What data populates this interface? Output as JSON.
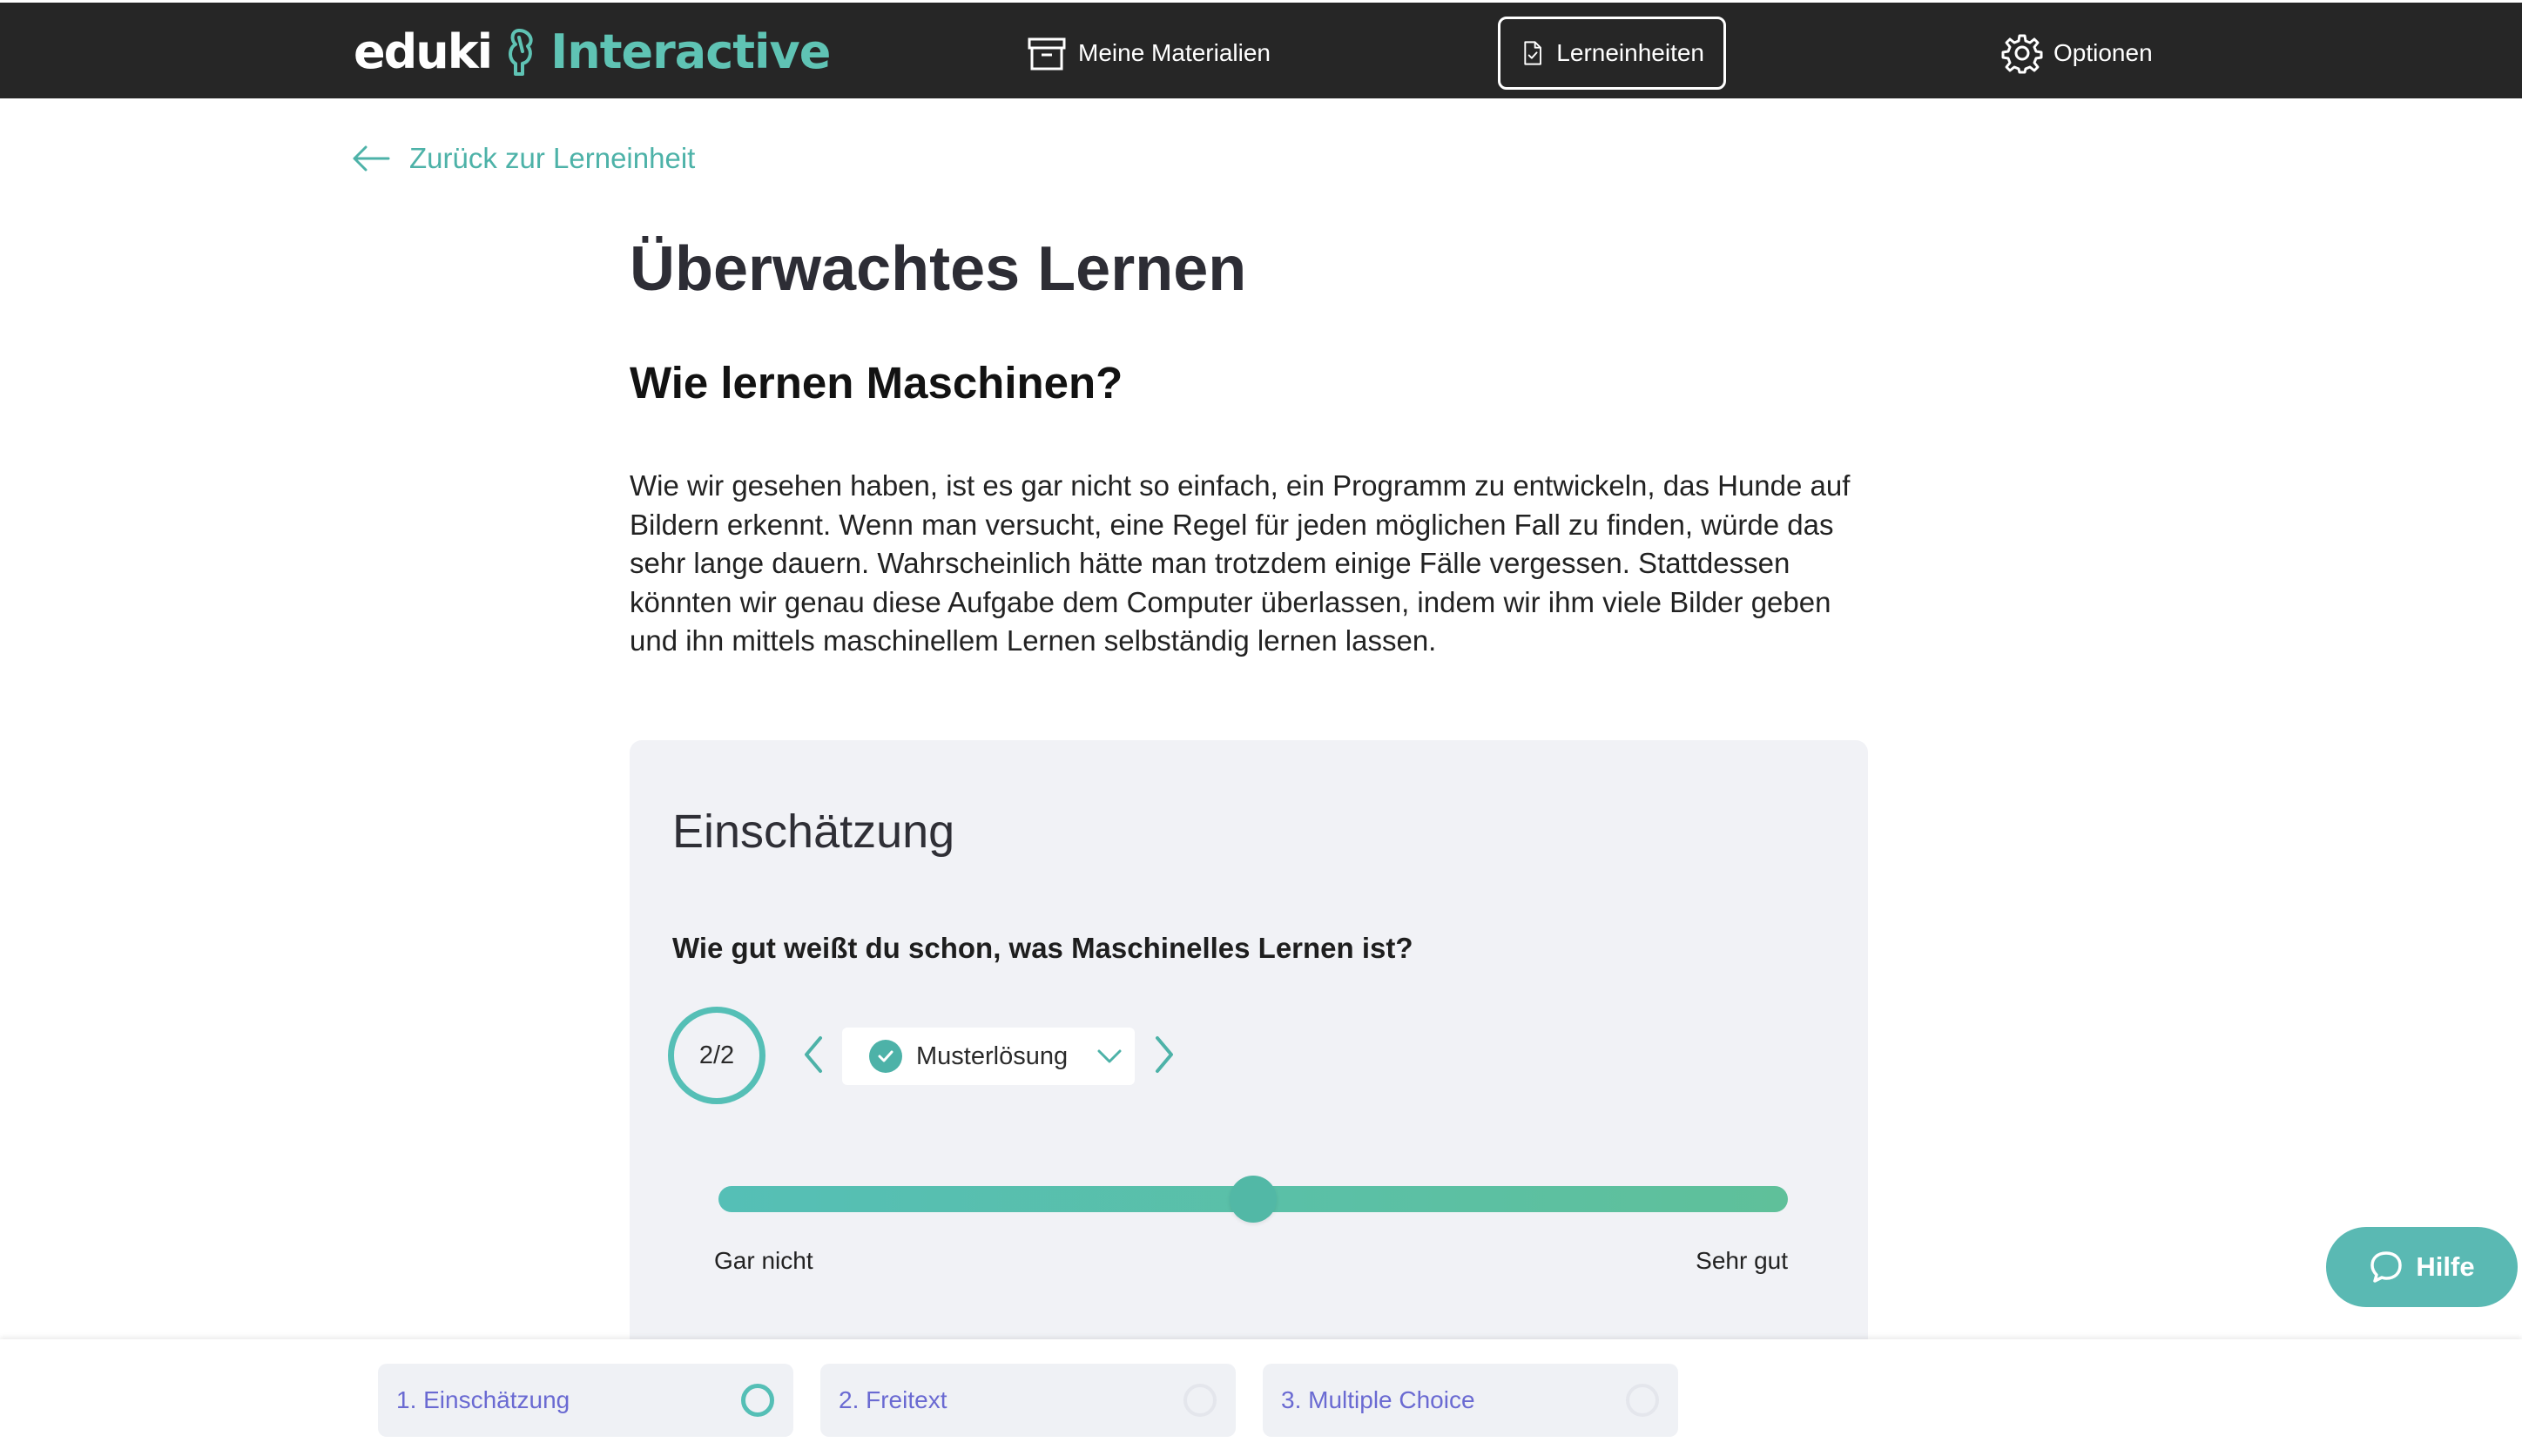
{
  "header": {
    "logo_left": "eduki",
    "logo_right": "Interactive",
    "nav": [
      {
        "label": "Meine Materialien",
        "icon": "archive-box-icon"
      },
      {
        "label": "Lerneinheiten",
        "icon": "document-check-icon",
        "active": true
      },
      {
        "label": "Optionen",
        "icon": "gear-icon"
      }
    ]
  },
  "back_link": {
    "label": "Zurück zur Lerneinheit",
    "icon": "arrow-left-icon"
  },
  "main": {
    "title": "Überwachtes Lernen",
    "section_title": "Wie lernen Maschinen?",
    "intro": "Wie wir gesehen haben, ist es gar nicht so einfach, ein Programm zu entwickeln, das Hunde auf Bildern erkennt. Wenn man versucht, eine Regel für jeden möglichen Fall zu finden, würde das sehr lange dauern. Wahrscheinlich hätte man trotzdem einige Fälle vergessen. Stattdessen könnten wir genau diese Aufgabe dem Computer überlassen, indem wir ihm viele Bilder geben und ihn mittels maschinellem Lernen selbständig lernen lassen."
  },
  "card": {
    "title": "Einschätzung",
    "question": "Wie gut weißt du schon, was Maschinelles Lernen ist?",
    "attempt": "2/2",
    "selected_option": "Musterlösung",
    "slider": {
      "min_label": "Gar nicht",
      "max_label": "Sehr gut",
      "value_fraction": 0.5
    }
  },
  "help": {
    "label": "Hilfe",
    "icon": "chat-bubble-icon"
  },
  "steps": [
    {
      "label": "1. Einschätzung",
      "active": true
    },
    {
      "label": "2. Freitext",
      "active": false
    },
    {
      "label": "3. Multiple Choice",
      "active": false
    }
  ],
  "colors": {
    "accent": "#55bfb6",
    "topbar": "#262626",
    "step_text": "#6a6ad2",
    "card_bg": "#f1f2f6"
  }
}
